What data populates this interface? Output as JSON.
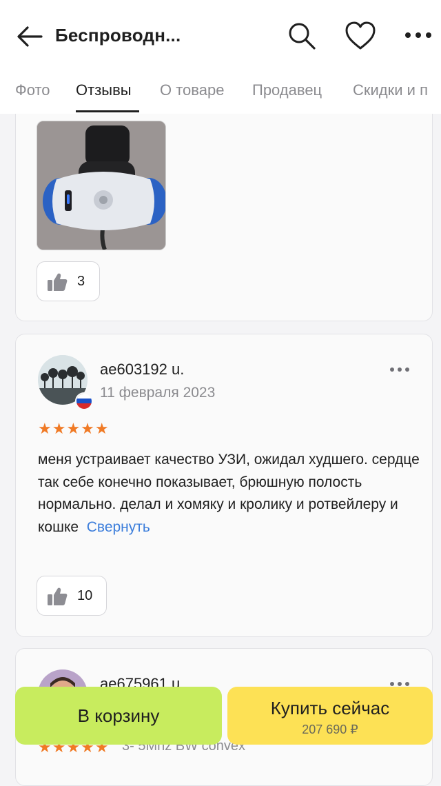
{
  "header": {
    "title": "Беспроводн...",
    "icons": [
      "back-arrow-icon",
      "search-icon",
      "heart-icon",
      "more-icon"
    ]
  },
  "tabs": [
    {
      "label": "Фото",
      "active": false
    },
    {
      "label": "Отзывы",
      "active": true
    },
    {
      "label": "О товаре",
      "active": false
    },
    {
      "label": "Продавец",
      "active": false
    },
    {
      "label": "Скидки и п",
      "active": false
    }
  ],
  "reviews": [
    {
      "likes": "3"
    },
    {
      "username": "ae603192 u.",
      "date": "11 февраля 2023",
      "stars": "★★★★★",
      "text": "меня устраивает качество УЗИ,  ожидал худшего. сердце так себе конечно показывает, брюшную полость нормально. делал и хомяку и кролику и ротвейлеру и кошке",
      "collapse_label": "Свернуть",
      "likes": "10"
    },
    {
      "username": "ae675961 u.",
      "stars": "★★★★★",
      "variant": "3- 5Mhz BW convex"
    }
  ],
  "actions": {
    "cart_label": "В корзину",
    "buy_label": "Купить сейчас",
    "buy_price": "207 690 ₽"
  },
  "colors": {
    "accent_star": "#f07a25",
    "link": "#3b7ddb",
    "cart_button": "#c8ec5e",
    "buy_button": "#fde155"
  }
}
